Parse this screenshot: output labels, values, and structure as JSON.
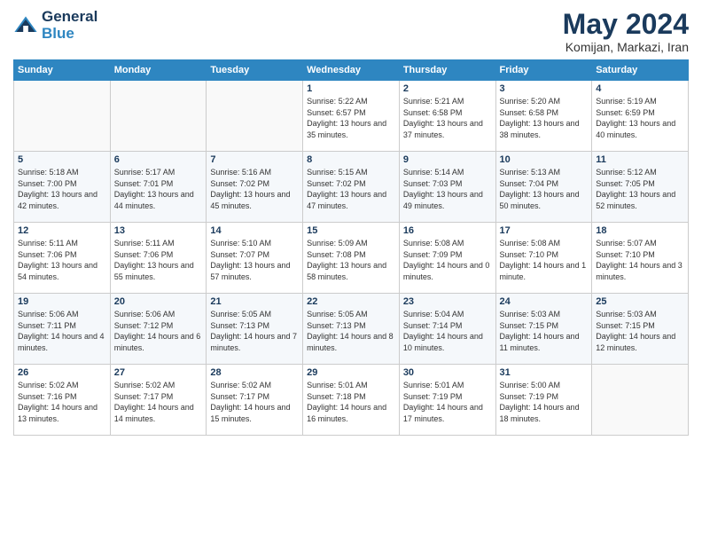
{
  "header": {
    "logo_line1": "General",
    "logo_line2": "Blue",
    "month": "May 2024",
    "location": "Komijan, Markazi, Iran"
  },
  "days_of_week": [
    "Sunday",
    "Monday",
    "Tuesday",
    "Wednesday",
    "Thursday",
    "Friday",
    "Saturday"
  ],
  "weeks": [
    [
      {
        "day": "",
        "info": ""
      },
      {
        "day": "",
        "info": ""
      },
      {
        "day": "",
        "info": ""
      },
      {
        "day": "1",
        "info": "Sunrise: 5:22 AM\nSunset: 6:57 PM\nDaylight: 13 hours and 35 minutes."
      },
      {
        "day": "2",
        "info": "Sunrise: 5:21 AM\nSunset: 6:58 PM\nDaylight: 13 hours and 37 minutes."
      },
      {
        "day": "3",
        "info": "Sunrise: 5:20 AM\nSunset: 6:58 PM\nDaylight: 13 hours and 38 minutes."
      },
      {
        "day": "4",
        "info": "Sunrise: 5:19 AM\nSunset: 6:59 PM\nDaylight: 13 hours and 40 minutes."
      }
    ],
    [
      {
        "day": "5",
        "info": "Sunrise: 5:18 AM\nSunset: 7:00 PM\nDaylight: 13 hours and 42 minutes."
      },
      {
        "day": "6",
        "info": "Sunrise: 5:17 AM\nSunset: 7:01 PM\nDaylight: 13 hours and 44 minutes."
      },
      {
        "day": "7",
        "info": "Sunrise: 5:16 AM\nSunset: 7:02 PM\nDaylight: 13 hours and 45 minutes."
      },
      {
        "day": "8",
        "info": "Sunrise: 5:15 AM\nSunset: 7:02 PM\nDaylight: 13 hours and 47 minutes."
      },
      {
        "day": "9",
        "info": "Sunrise: 5:14 AM\nSunset: 7:03 PM\nDaylight: 13 hours and 49 minutes."
      },
      {
        "day": "10",
        "info": "Sunrise: 5:13 AM\nSunset: 7:04 PM\nDaylight: 13 hours and 50 minutes."
      },
      {
        "day": "11",
        "info": "Sunrise: 5:12 AM\nSunset: 7:05 PM\nDaylight: 13 hours and 52 minutes."
      }
    ],
    [
      {
        "day": "12",
        "info": "Sunrise: 5:11 AM\nSunset: 7:06 PM\nDaylight: 13 hours and 54 minutes."
      },
      {
        "day": "13",
        "info": "Sunrise: 5:11 AM\nSunset: 7:06 PM\nDaylight: 13 hours and 55 minutes."
      },
      {
        "day": "14",
        "info": "Sunrise: 5:10 AM\nSunset: 7:07 PM\nDaylight: 13 hours and 57 minutes."
      },
      {
        "day": "15",
        "info": "Sunrise: 5:09 AM\nSunset: 7:08 PM\nDaylight: 13 hours and 58 minutes."
      },
      {
        "day": "16",
        "info": "Sunrise: 5:08 AM\nSunset: 7:09 PM\nDaylight: 14 hours and 0 minutes."
      },
      {
        "day": "17",
        "info": "Sunrise: 5:08 AM\nSunset: 7:10 PM\nDaylight: 14 hours and 1 minute."
      },
      {
        "day": "18",
        "info": "Sunrise: 5:07 AM\nSunset: 7:10 PM\nDaylight: 14 hours and 3 minutes."
      }
    ],
    [
      {
        "day": "19",
        "info": "Sunrise: 5:06 AM\nSunset: 7:11 PM\nDaylight: 14 hours and 4 minutes."
      },
      {
        "day": "20",
        "info": "Sunrise: 5:06 AM\nSunset: 7:12 PM\nDaylight: 14 hours and 6 minutes."
      },
      {
        "day": "21",
        "info": "Sunrise: 5:05 AM\nSunset: 7:13 PM\nDaylight: 14 hours and 7 minutes."
      },
      {
        "day": "22",
        "info": "Sunrise: 5:05 AM\nSunset: 7:13 PM\nDaylight: 14 hours and 8 minutes."
      },
      {
        "day": "23",
        "info": "Sunrise: 5:04 AM\nSunset: 7:14 PM\nDaylight: 14 hours and 10 minutes."
      },
      {
        "day": "24",
        "info": "Sunrise: 5:03 AM\nSunset: 7:15 PM\nDaylight: 14 hours and 11 minutes."
      },
      {
        "day": "25",
        "info": "Sunrise: 5:03 AM\nSunset: 7:15 PM\nDaylight: 14 hours and 12 minutes."
      }
    ],
    [
      {
        "day": "26",
        "info": "Sunrise: 5:02 AM\nSunset: 7:16 PM\nDaylight: 14 hours and 13 minutes."
      },
      {
        "day": "27",
        "info": "Sunrise: 5:02 AM\nSunset: 7:17 PM\nDaylight: 14 hours and 14 minutes."
      },
      {
        "day": "28",
        "info": "Sunrise: 5:02 AM\nSunset: 7:17 PM\nDaylight: 14 hours and 15 minutes."
      },
      {
        "day": "29",
        "info": "Sunrise: 5:01 AM\nSunset: 7:18 PM\nDaylight: 14 hours and 16 minutes."
      },
      {
        "day": "30",
        "info": "Sunrise: 5:01 AM\nSunset: 7:19 PM\nDaylight: 14 hours and 17 minutes."
      },
      {
        "day": "31",
        "info": "Sunrise: 5:00 AM\nSunset: 7:19 PM\nDaylight: 14 hours and 18 minutes."
      },
      {
        "day": "",
        "info": ""
      }
    ]
  ]
}
